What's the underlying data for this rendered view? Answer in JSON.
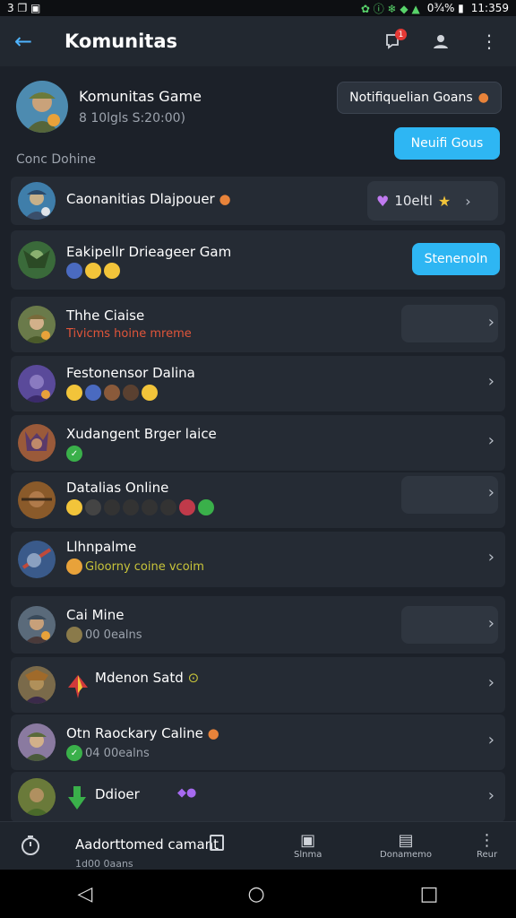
{
  "status_bar": {
    "left": "3 ❐ ▣",
    "right_icons": "✿ ⓘ ❄ ◆ ▲",
    "battery": "0¾% ▮",
    "time": "11:359"
  },
  "app_bar": {
    "title": "Komunitas",
    "badge": "1"
  },
  "header": {
    "title": "Komunitas Game",
    "subtitle": "8 10lgls S:20:00)",
    "notif_label": "Notifiquelian Goans",
    "action_label": "Neuifi Gous",
    "section_label": "Conc Dohine"
  },
  "rows": [
    {
      "title": "Caonanitias Dlajpouer",
      "title_icon": "●",
      "right_label": "10eltl",
      "right_icon_left": "♥",
      "right_icon_right": "★"
    },
    {
      "title": "Eakipellr Drieageer Gam",
      "button": "Stenenoln"
    },
    {
      "title": "Thhe Ciaise",
      "sub": "Tivicms hoine mreme"
    },
    {
      "title": "Festonensor Dalina"
    },
    {
      "title": "Xudangent Brger laice"
    },
    {
      "title": "Datalias Online"
    },
    {
      "title": "Llhnpalme",
      "sub": "Gloorny coine vcoim"
    },
    {
      "title": "Cai Mine",
      "sub": "00 0ealns"
    },
    {
      "title": "Mdenon Satd",
      "title_icon": "⊙"
    },
    {
      "title": "Otn Raockary Caline",
      "title_icon": "●",
      "sub": "04 00ealns"
    },
    {
      "title": "Ddioer",
      "title_icon": "◆●"
    }
  ],
  "bottom_nav": {
    "text": "Aadorttomed camant",
    "sub": "1d00 0aans",
    "items": [
      "Slnma",
      "Donamemo",
      "Reur"
    ]
  },
  "colors": {
    "accent": "#2eb6f3",
    "background": "#1c2129",
    "row": "#252b34"
  }
}
